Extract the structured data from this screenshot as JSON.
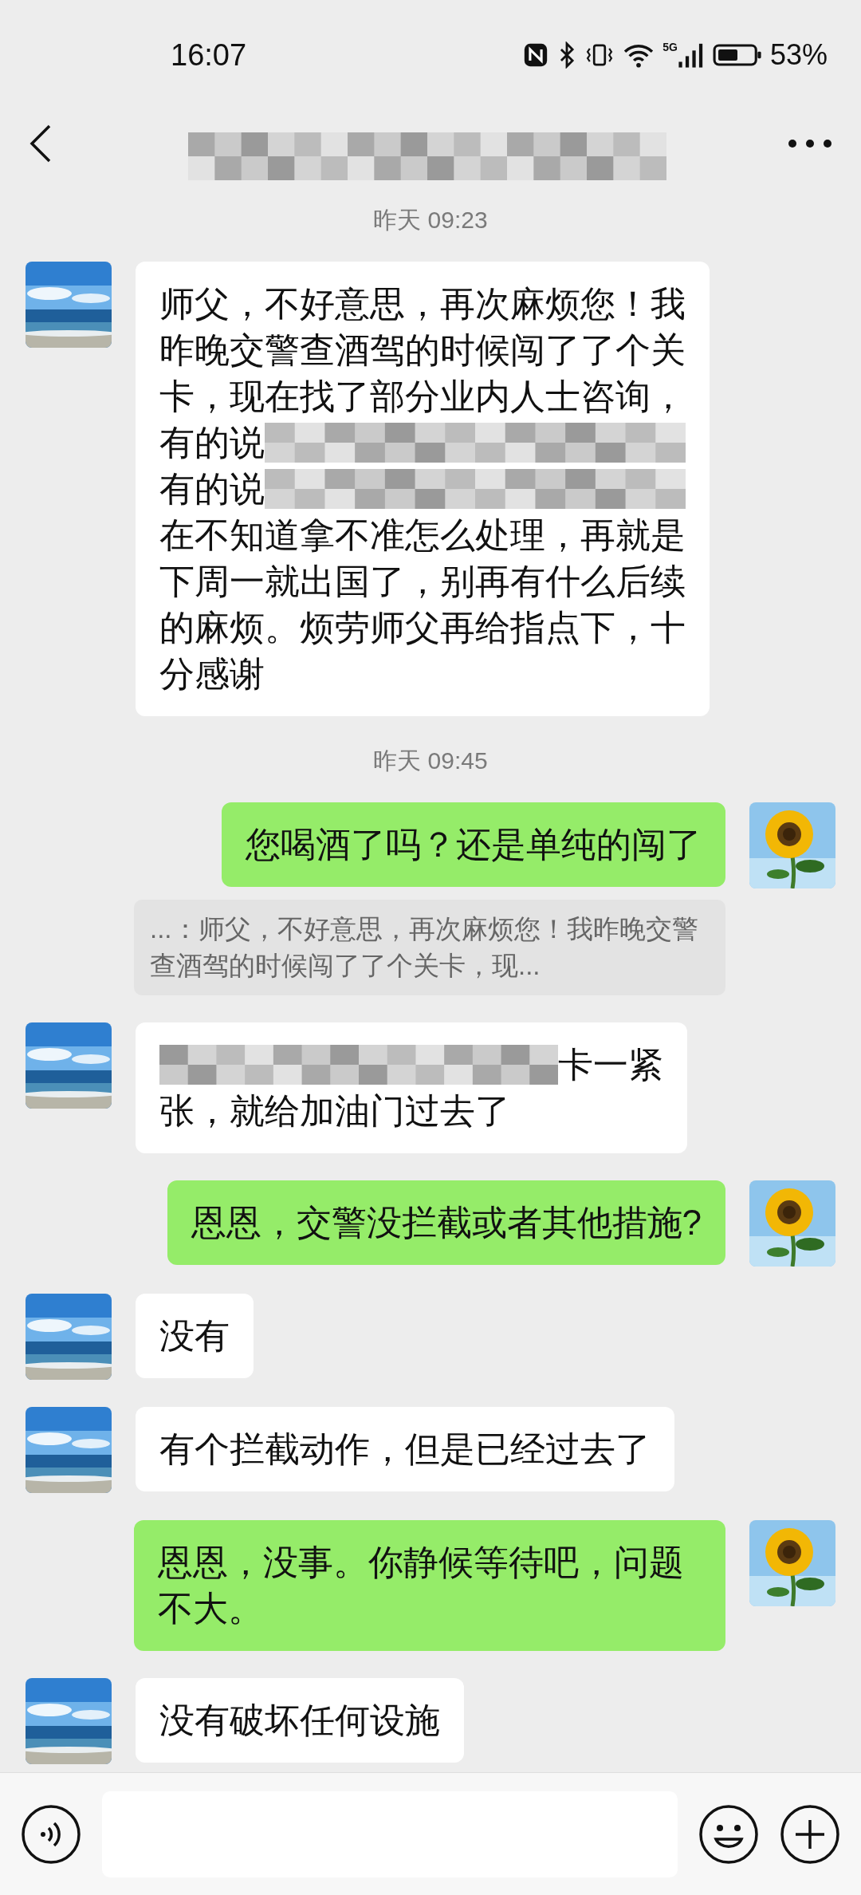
{
  "status_bar": {
    "time": "16:07",
    "network": "5G",
    "battery": "53%"
  },
  "chat": [
    {
      "kind": "time",
      "text": "昨天 09:23"
    },
    {
      "kind": "received",
      "lines": [
        [
          {
            "kind": "text",
            "text": "师父，不好意思，再次麻烦您！我"
          }
        ],
        [
          {
            "kind": "text",
            "text": "昨晚交警查酒驾的时候闯了了个关"
          }
        ],
        [
          {
            "kind": "text",
            "text": "卡，现在找了部分业内人士咨询，"
          }
        ],
        [
          {
            "kind": "text",
            "text": "有的说"
          },
          {
            "kind": "redacted"
          }
        ],
        [
          {
            "kind": "text",
            "text": "有的说"
          },
          {
            "kind": "redacted"
          }
        ],
        [
          {
            "kind": "text",
            "text": "在不知道拿不准怎么处理，再就是"
          }
        ],
        [
          {
            "kind": "text",
            "text": "下周一就出国了，别再有什么后续"
          }
        ],
        [
          {
            "kind": "text",
            "text": "的麻烦。烦劳师父再给指点下，十"
          }
        ],
        [
          {
            "kind": "text",
            "text": "分感谢"
          }
        ]
      ]
    },
    {
      "kind": "time",
      "text": "昨天 09:45"
    },
    {
      "kind": "sent",
      "text": "您喝酒了吗？还是单纯的闯了"
    },
    {
      "kind": "quote",
      "text": "...：师父，不好意思，再次麻烦您！我昨晚交警查酒驾的时候闯了了个关卡，现..."
    },
    {
      "kind": "received",
      "lines": [
        [
          {
            "kind": "redacted"
          },
          {
            "kind": "text",
            "text": "卡一紧"
          }
        ],
        [
          {
            "kind": "text",
            "text": "张，就给加油门过去了"
          }
        ]
      ]
    },
    {
      "kind": "sent",
      "text": "恩恩，交警没拦截或者其他措施?"
    },
    {
      "kind": "received",
      "text": "没有"
    },
    {
      "kind": "received",
      "text": "有个拦截动作，但是已经过去了"
    },
    {
      "kind": "sent",
      "text": "恩恩，没事。你静候等待吧，问题不大。"
    },
    {
      "kind": "received",
      "text": "没有破坏任何设施"
    }
  ]
}
